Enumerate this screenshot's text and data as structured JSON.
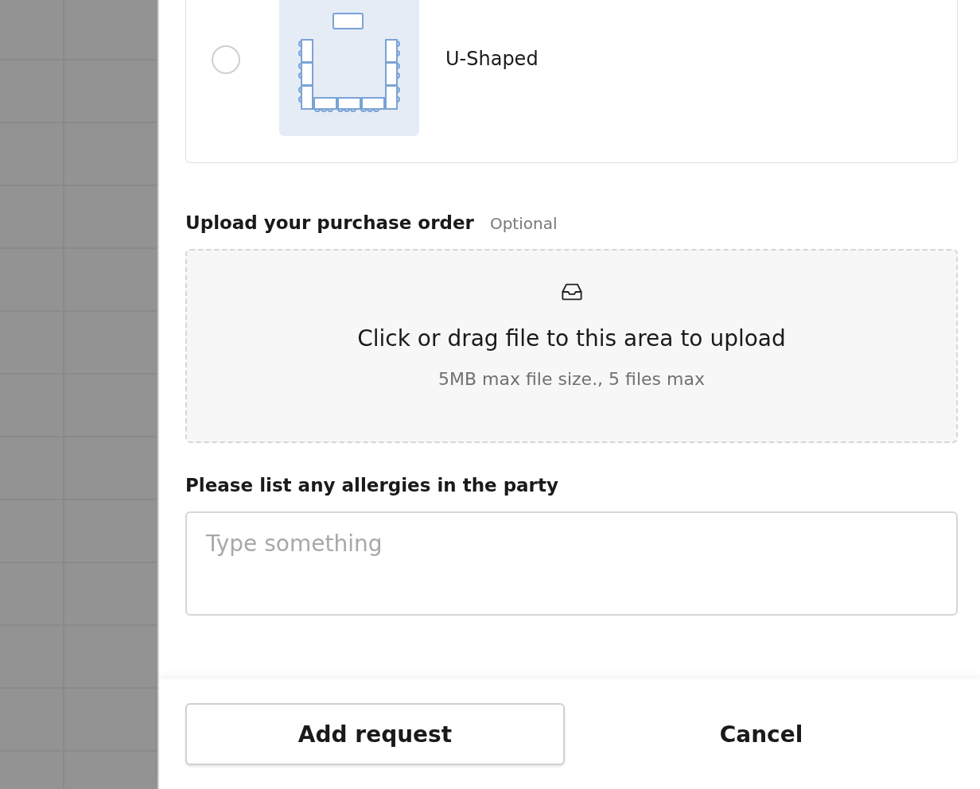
{
  "layout_options": [
    {
      "label": "U-Shaped",
      "selected": false
    }
  ],
  "upload": {
    "label": "Upload your purchase order",
    "optional": "Optional",
    "prompt": "Click or drag file to this area to upload",
    "hint": "5MB max file size., 5 files max"
  },
  "allergies": {
    "label": "Please list any allergies in the party",
    "placeholder": "Type something"
  },
  "buttons": [
    {
      "label": "Add request",
      "kind": "outlined"
    },
    {
      "label": "Cancel",
      "kind": "text"
    }
  ]
}
